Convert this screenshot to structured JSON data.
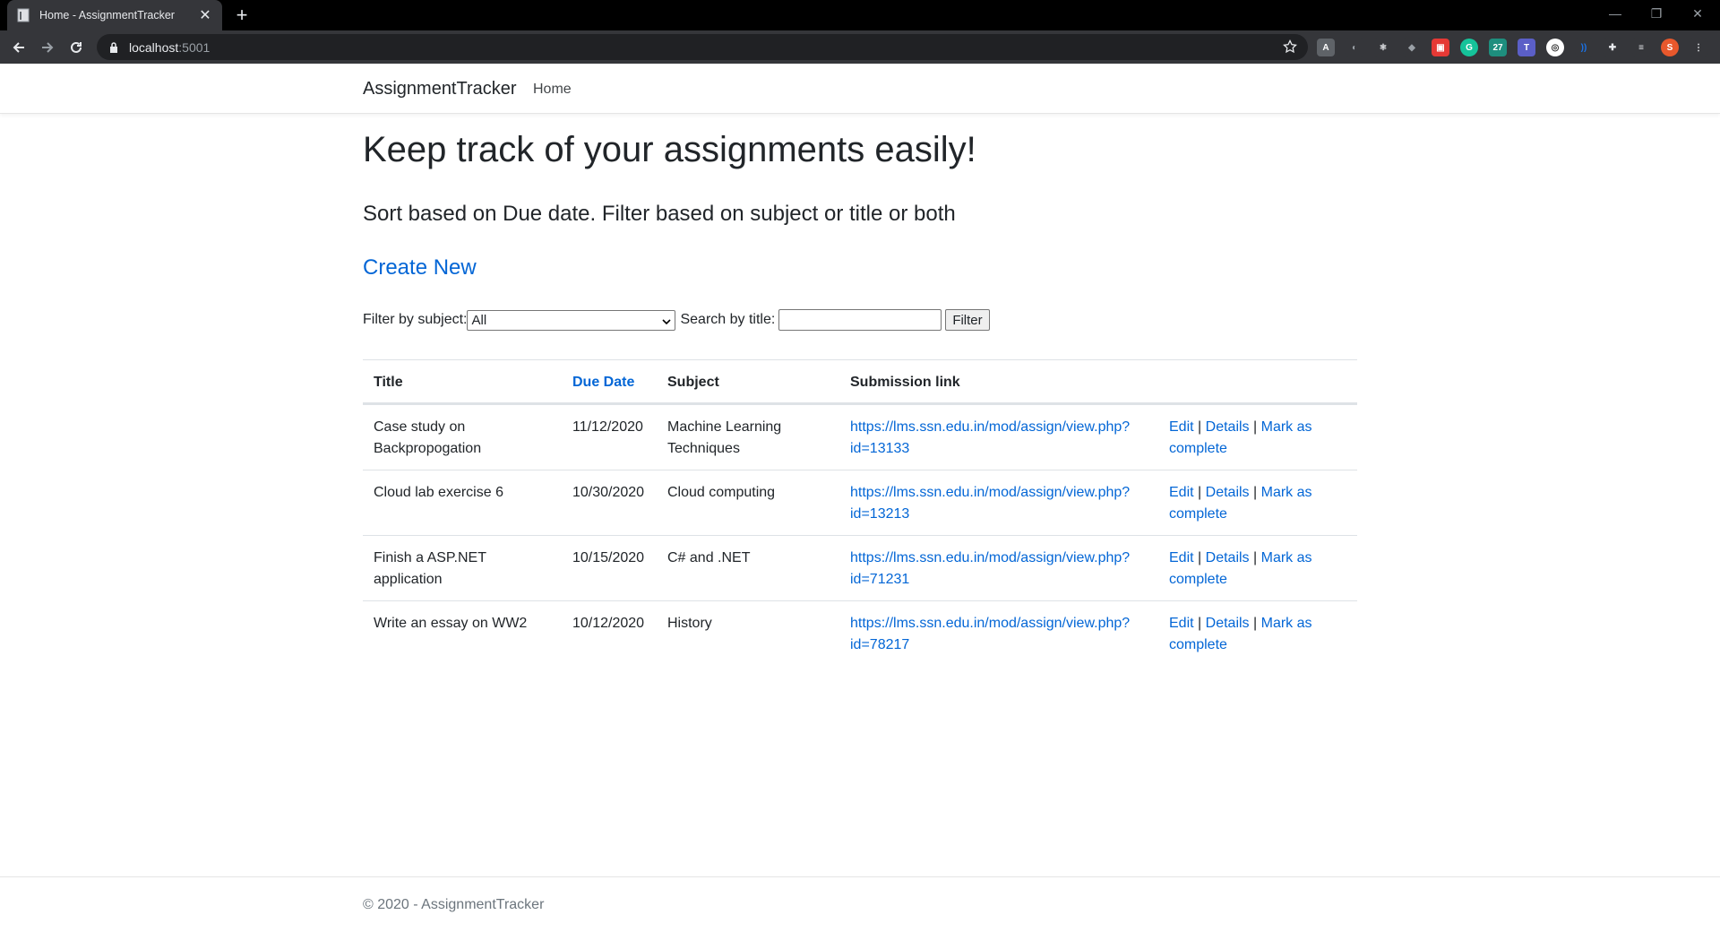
{
  "browser": {
    "tab_title": "Home - AssignmentTracker",
    "url_host": "localhost",
    "url_port": ":5001"
  },
  "nav": {
    "brand": "AssignmentTracker",
    "home": "Home"
  },
  "hero": {
    "title": "Keep track of your assignments easily!",
    "subtitle": "Sort based on Due date. Filter based on subject or title or both",
    "create_new": "Create New"
  },
  "filter": {
    "subject_label": "Filter by subject:",
    "subject_value": "All",
    "title_label": "Search by title:",
    "title_value": "",
    "button": "Filter"
  },
  "table": {
    "headers": [
      "Title",
      "Due Date",
      "Subject",
      "Submission link"
    ],
    "rows": [
      {
        "title_l1": "Case study on",
        "title_l2": "Backpropogation",
        "due": "11/12/2020",
        "subject_l1": "Machine Learning",
        "subject_l2": "Techniques",
        "link_l1": "https://lms.ssn.edu.in/mod/assign/view.php?",
        "link_l2": "id=13133"
      },
      {
        "title_l1": "Cloud lab exercise 6",
        "title_l2": "",
        "due": "10/30/2020",
        "subject_l1": "Cloud computing",
        "subject_l2": "",
        "link_l1": "https://lms.ssn.edu.in/mod/assign/view.php?",
        "link_l2": "id=13213"
      },
      {
        "title_l1": "Finish a ASP.NET",
        "title_l2": "application",
        "due": "10/15/2020",
        "subject_l1": "C# and .NET",
        "subject_l2": "",
        "link_l1": "https://lms.ssn.edu.in/mod/assign/view.php?",
        "link_l2": "id=71231"
      },
      {
        "title_l1": "Write an essay on WW2",
        "title_l2": "",
        "due": "10/12/2020",
        "subject_l1": "History",
        "subject_l2": "",
        "link_l1": "https://lms.ssn.edu.in/mod/assign/view.php?",
        "link_l2": "id=78217"
      }
    ],
    "actions": {
      "edit": "Edit",
      "details": "Details",
      "mark_l1": "Mark as",
      "mark_l2": "complete",
      "sep": "|"
    }
  },
  "footer": {
    "text": "© 2020 - AssignmentTracker"
  },
  "colors": {
    "link": "#0366d6",
    "text": "#212529",
    "muted": "#6c757d"
  }
}
